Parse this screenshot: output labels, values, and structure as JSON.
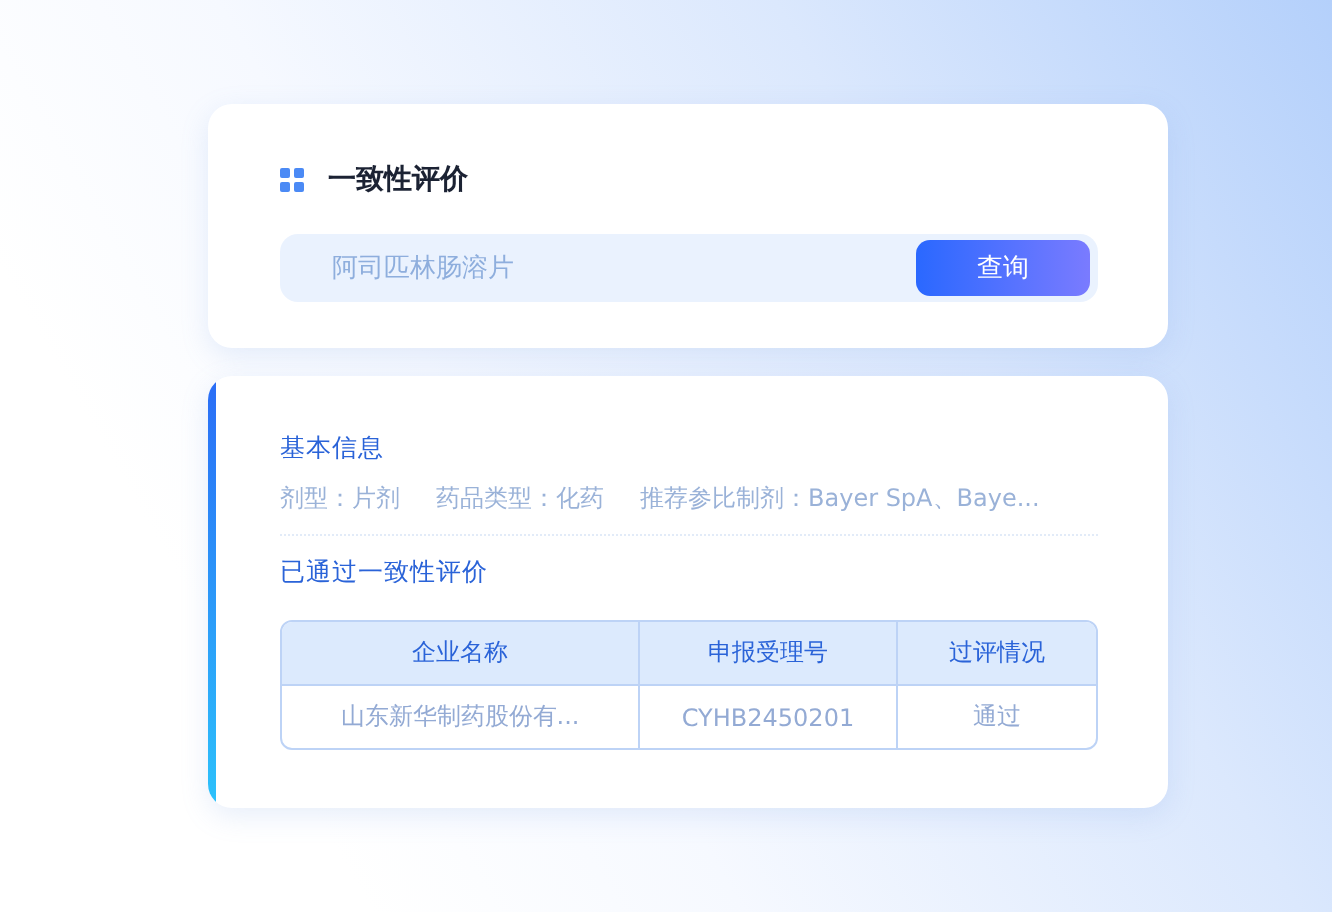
{
  "search_card": {
    "title": "一致性评价",
    "search": {
      "placeholder": "阿司匹林肠溶片"
    },
    "button": "查询"
  },
  "result_card": {
    "info_title": "基本信息",
    "info_fields": [
      "剂型：片剂",
      "药品类型：化药",
      "推荐参比制剂：Bayer SpA、Baye..."
    ],
    "section_title": "已通过一致性评价",
    "table": {
      "columns": [
        "企业名称",
        "申报受理号",
        "过评情况"
      ],
      "rows": [
        [
          "山东新华制药股份有...",
          "CYHB2450201",
          "通过"
        ]
      ]
    }
  }
}
